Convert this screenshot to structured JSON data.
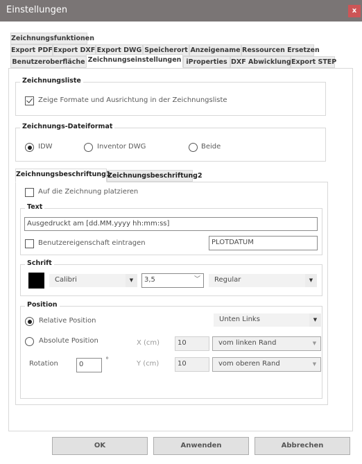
{
  "window": {
    "title": "Einstellungen",
    "close_label": "x",
    "close_color": "#cd5556",
    "titlebar_color": "#7a7575"
  },
  "tabs": {
    "row1": [
      {
        "label": "Zeichnungsfunktionen"
      }
    ],
    "row2": [
      {
        "label": "Export PDF"
      },
      {
        "label": "Export DXF"
      },
      {
        "label": "Export DWG"
      },
      {
        "label": "Speicherort"
      },
      {
        "label": "Anzeigename"
      },
      {
        "label": "Ressourcen Ersetzen"
      }
    ],
    "row3": [
      {
        "label": "Benutzeroberfläche"
      },
      {
        "label": "Zeichnungseinstellungen",
        "active": true
      },
      {
        "label": "iProperties"
      },
      {
        "label": "DXF Abwicklung"
      },
      {
        "label": "Export STEP"
      }
    ]
  },
  "zeichnungsliste": {
    "title": "Zeichnungsliste",
    "checkbox_label": "Zeige Formate und Ausrichtung in der Zeichnungsliste",
    "checked": true
  },
  "dateiformat": {
    "title": "Zeichnungs-Dateiformat",
    "options": [
      {
        "label": "IDW",
        "selected": true
      },
      {
        "label": "Inventor DWG",
        "selected": false
      },
      {
        "label": "Beide",
        "selected": false
      }
    ]
  },
  "subtabs": [
    {
      "label": "Zeichnungsbeschriftung1",
      "active": true
    },
    {
      "label": "Zeichnungsbeschriftung2",
      "active": false
    }
  ],
  "beschriftung": {
    "place_label": "Auf die Zeichnung platzieren",
    "place_checked": false,
    "text": {
      "title": "Text",
      "value": "Ausgedruckt am [dd.MM.yyyy hh:mm:ss]",
      "user_prop_label": "Benutzereigenschaft eintragen",
      "user_prop_checked": false,
      "user_prop_value": "PLOTDATUM"
    },
    "schrift": {
      "title": "Schrift",
      "color": "#000000",
      "font": "Calibri",
      "size": "3,5",
      "style": "Regular"
    },
    "position": {
      "title": "Position",
      "relative_label": "Relative Position",
      "relative_selected": true,
      "relative_value": "Unten Links",
      "absolute_label": "Absolute Position",
      "absolute_selected": false,
      "x_label": "X (cm)",
      "x_value": "10",
      "x_ref": "vom linken Rand",
      "y_label": "Y (cm)",
      "y_value": "10",
      "y_ref": "vom oberen Rand",
      "rotation_label": "Rotation",
      "rotation_value": "0",
      "rotation_unit": "°"
    }
  },
  "buttons": {
    "ok": "OK",
    "apply": "Anwenden",
    "cancel": "Abbrechen"
  },
  "icons": {
    "dropdown": "▼",
    "chevron": "﹀"
  }
}
